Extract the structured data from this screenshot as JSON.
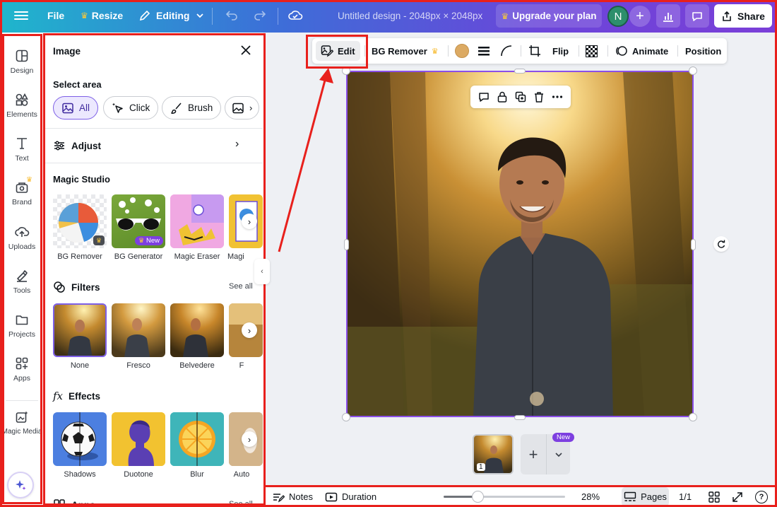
{
  "topbar": {
    "file_label": "File",
    "resize_label": "Resize",
    "editing_label": "Editing",
    "doc_title": "Untitled design - 2048px × 2048px",
    "upgrade_label": "Upgrade your plan",
    "avatar_initial": "N",
    "share_label": "Share"
  },
  "rail": {
    "items": [
      {
        "label": "Design",
        "icon": "design-icon"
      },
      {
        "label": "Elements",
        "icon": "elements-icon"
      },
      {
        "label": "Text",
        "icon": "text-icon"
      },
      {
        "label": "Brand",
        "icon": "brand-icon"
      },
      {
        "label": "Uploads",
        "icon": "uploads-icon"
      },
      {
        "label": "Tools",
        "icon": "tools-icon"
      },
      {
        "label": "Projects",
        "icon": "projects-icon"
      },
      {
        "label": "Apps",
        "icon": "apps-icon"
      },
      {
        "label": "Magic Media",
        "icon": "magic-media-icon"
      }
    ]
  },
  "panel": {
    "title": "Image",
    "select_area": {
      "heading": "Select area",
      "chips": [
        "All",
        "Click",
        "Brush"
      ]
    },
    "adjust_label": "Adjust",
    "magic_studio": {
      "heading": "Magic Studio",
      "tiles": [
        "BG Remover",
        "BG Generator",
        "Magic Eraser",
        "Magi"
      ],
      "new_badge": "New"
    },
    "filters": {
      "heading": "Filters",
      "see_all": "See all",
      "tiles": [
        "None",
        "Fresco",
        "Belvedere",
        "F"
      ]
    },
    "effects": {
      "heading": "Effects",
      "tiles": [
        "Shadows",
        "Duotone",
        "Blur",
        "Auto"
      ]
    },
    "apps": {
      "heading": "Apps",
      "see_all": "See all"
    }
  },
  "context_toolbar": {
    "edit_label": "Edit",
    "bg_remover_label": "BG Remover",
    "flip_label": "Flip",
    "animate_label": "Animate",
    "position_label": "Position",
    "color_swatch": "#dcaa63"
  },
  "pages": {
    "thumb_number": "1",
    "new_badge": "New"
  },
  "bottombar": {
    "notes_label": "Notes",
    "duration_label": "Duration",
    "zoom": "28%",
    "zoom_fraction": 0.28,
    "pages_label": "Pages",
    "page_count": "1/1",
    "help_label": "?"
  },
  "colors": {
    "accent": "#8b4fe8",
    "annotation": "#e8201c",
    "new_badge": "#7d3fe0"
  }
}
